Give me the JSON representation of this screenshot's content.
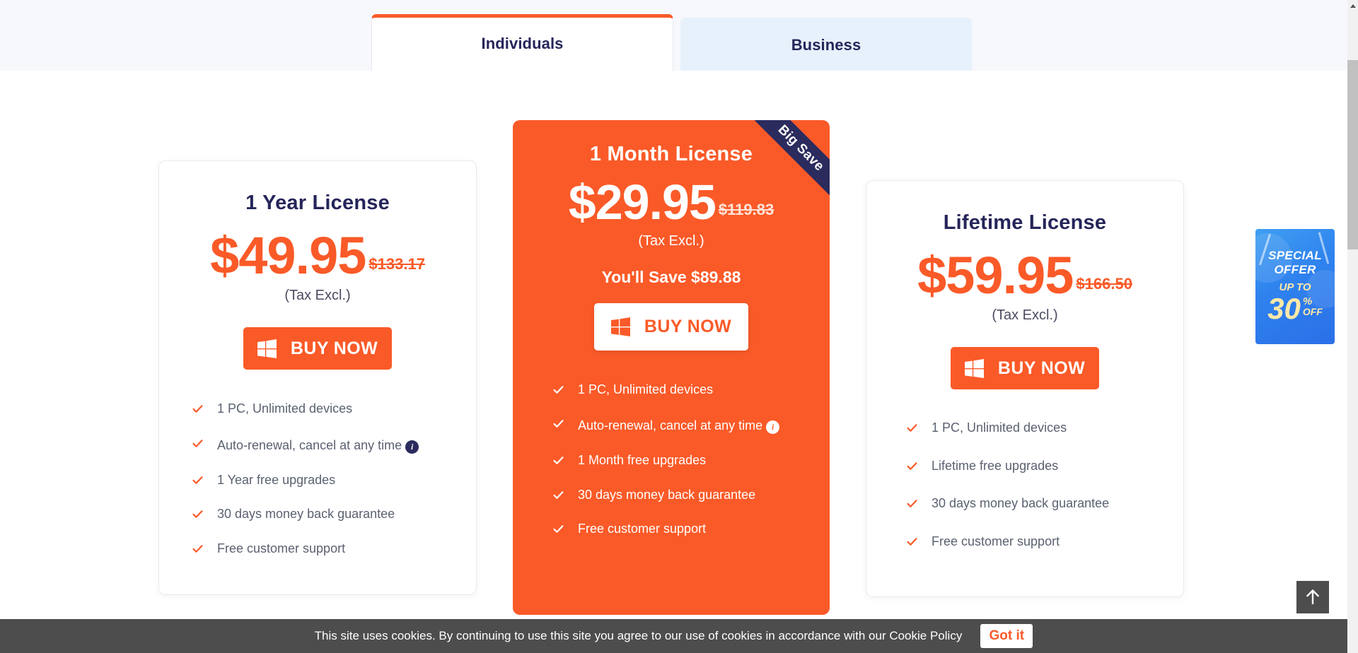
{
  "tabs": [
    {
      "label": "Individuals",
      "active": true
    },
    {
      "label": "Business",
      "active": false
    }
  ],
  "colors": {
    "accent": "#fa5a28",
    "navy": "#25255a",
    "ribbon": "#2b2b5e",
    "cookie_bar": "#4d4d4d",
    "tab_inactive": "#e7f1fb"
  },
  "plans": [
    {
      "id": "one-year",
      "title": "1 Year License",
      "price": "$49.95",
      "old_price": "$133.17",
      "tax_note": "(Tax Excl.)",
      "buy_label": "BUY NOW",
      "buy_icon": "windows-icon",
      "features": [
        {
          "text": "1 PC, Unlimited devices",
          "info": false
        },
        {
          "text": "Auto-renewal, cancel at any time",
          "info": true,
          "info_label": "i"
        },
        {
          "text": "1 Year free upgrades",
          "info": false
        },
        {
          "text": "30 days money back guarantee",
          "info": false
        },
        {
          "text": "Free customer support",
          "info": false
        }
      ]
    },
    {
      "id": "one-month",
      "title": "1 Month License",
      "price": "$29.95",
      "old_price": "$119.83",
      "tax_note": "(Tax Excl.)",
      "save_text": "You'll Save $89.88",
      "ribbon": "Big Save",
      "buy_label": "BUY NOW",
      "buy_icon": "windows-icon",
      "features": [
        {
          "text": "1 PC, Unlimited devices",
          "info": false
        },
        {
          "text": "Auto-renewal, cancel at any time",
          "info": true,
          "info_label": "i"
        },
        {
          "text": "1 Month free upgrades",
          "info": false
        },
        {
          "text": "30 days money back guarantee",
          "info": false
        },
        {
          "text": "Free customer support",
          "info": false
        }
      ]
    },
    {
      "id": "lifetime",
      "title": "Lifetime License",
      "price": "$59.95",
      "old_price": "$166.50",
      "tax_note": "(Tax Excl.)",
      "buy_label": "BUY NOW",
      "buy_icon": "windows-icon",
      "features": [
        {
          "text": "1 PC, Unlimited devices",
          "info": false
        },
        {
          "text": "Lifetime free upgrades",
          "info": false
        },
        {
          "text": "30 days money back guarantee",
          "info": false
        },
        {
          "text": "Free customer support",
          "info": false
        }
      ]
    }
  ],
  "special_offer": {
    "line1": "SPECIAL",
    "line2": "OFFER",
    "up_to": "UP TO",
    "number": "30",
    "percent": "%",
    "off": "OFF"
  },
  "scroll_top": {
    "icon": "arrow-up-icon"
  },
  "cookie": {
    "text": "This site uses cookies. By continuing to use this site you agree to our use of cookies in accordance with our Cookie Policy",
    "button": "Got it"
  }
}
